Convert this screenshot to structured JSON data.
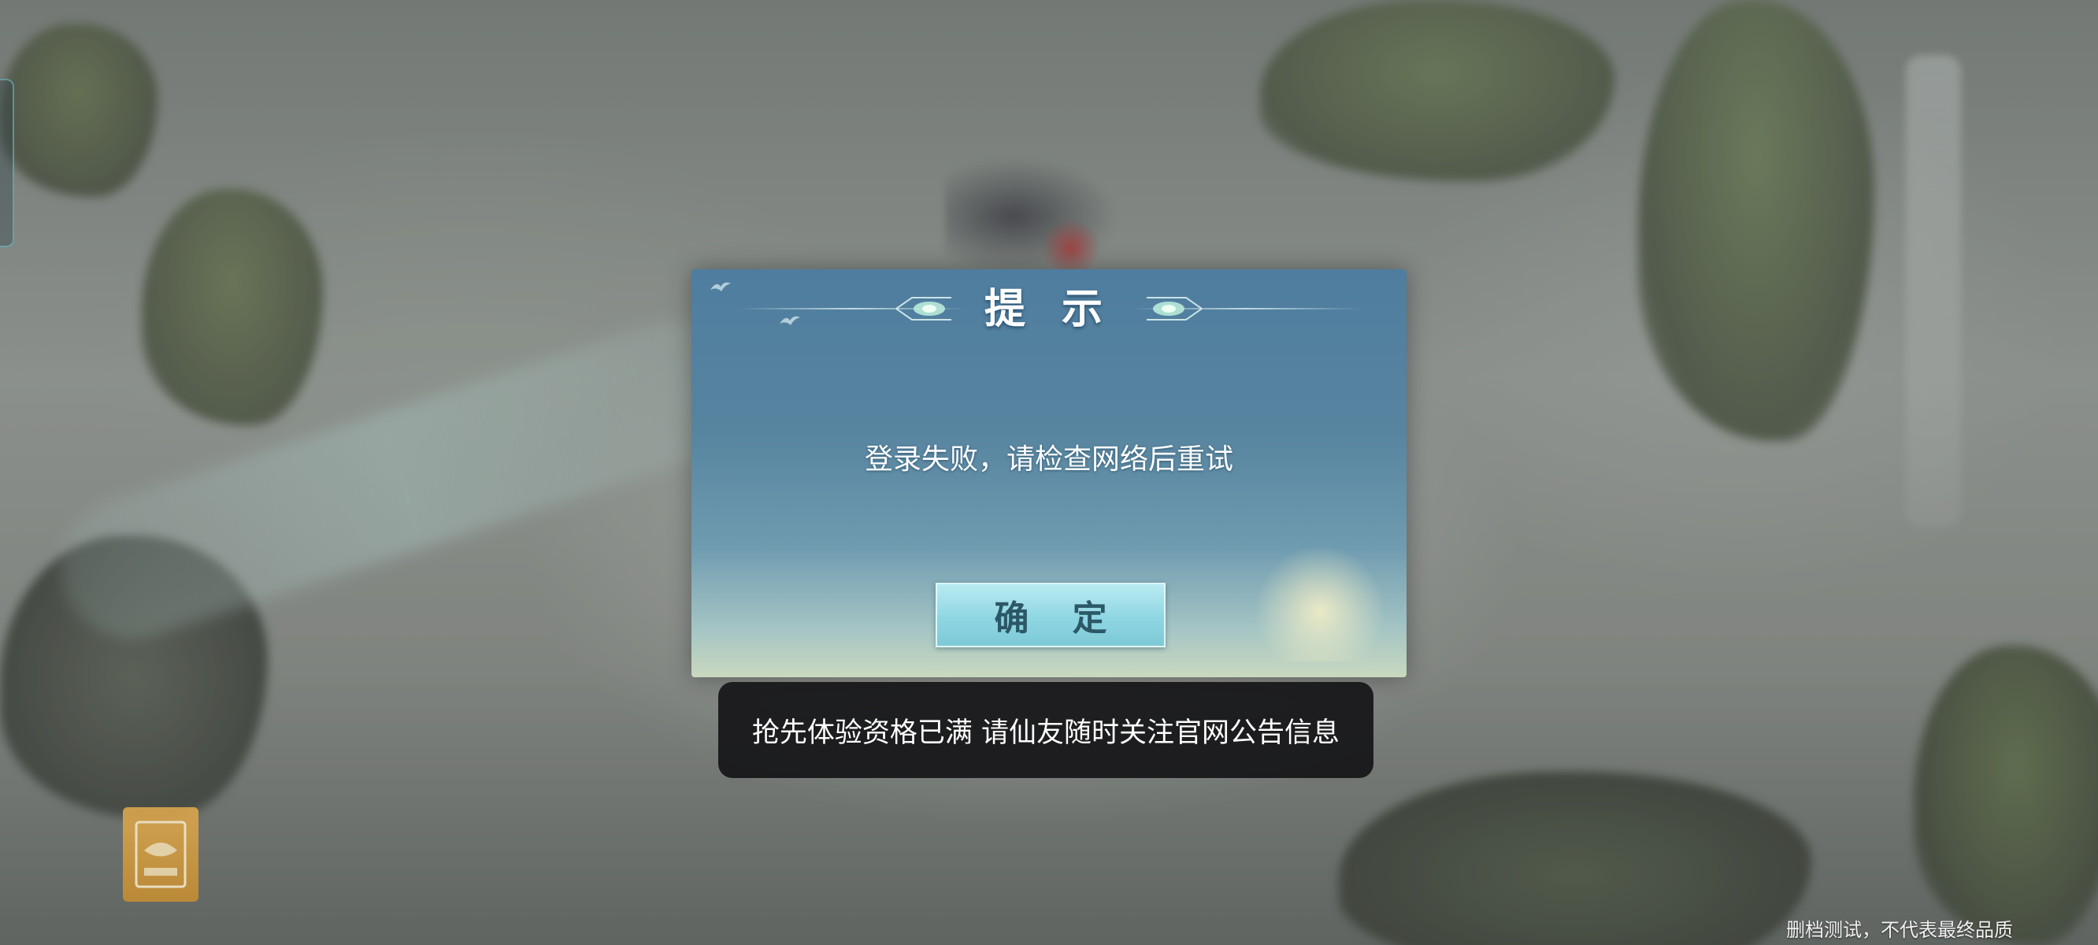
{
  "dialog": {
    "title": "提 示",
    "message": "登录失败，请检查网络后重试",
    "confirm_label": "确 定"
  },
  "toast": {
    "message": "抢先体验资格已满 请仙友随时关注官网公告信息"
  },
  "footer": {
    "note": "删档测试，不代表最终品质"
  },
  "colors": {
    "dialog_top": "#4f7d9f",
    "dialog_bottom": "#c9d9bf",
    "button": "#8fd6e3",
    "toast_bg": "#161618",
    "age_badge": "#e3ac4e"
  },
  "icons": {
    "age_badge": "age-rating-badge-icon",
    "dialog_ornaments": "lotus-ornament-icon",
    "birds": "swallow-icon"
  }
}
